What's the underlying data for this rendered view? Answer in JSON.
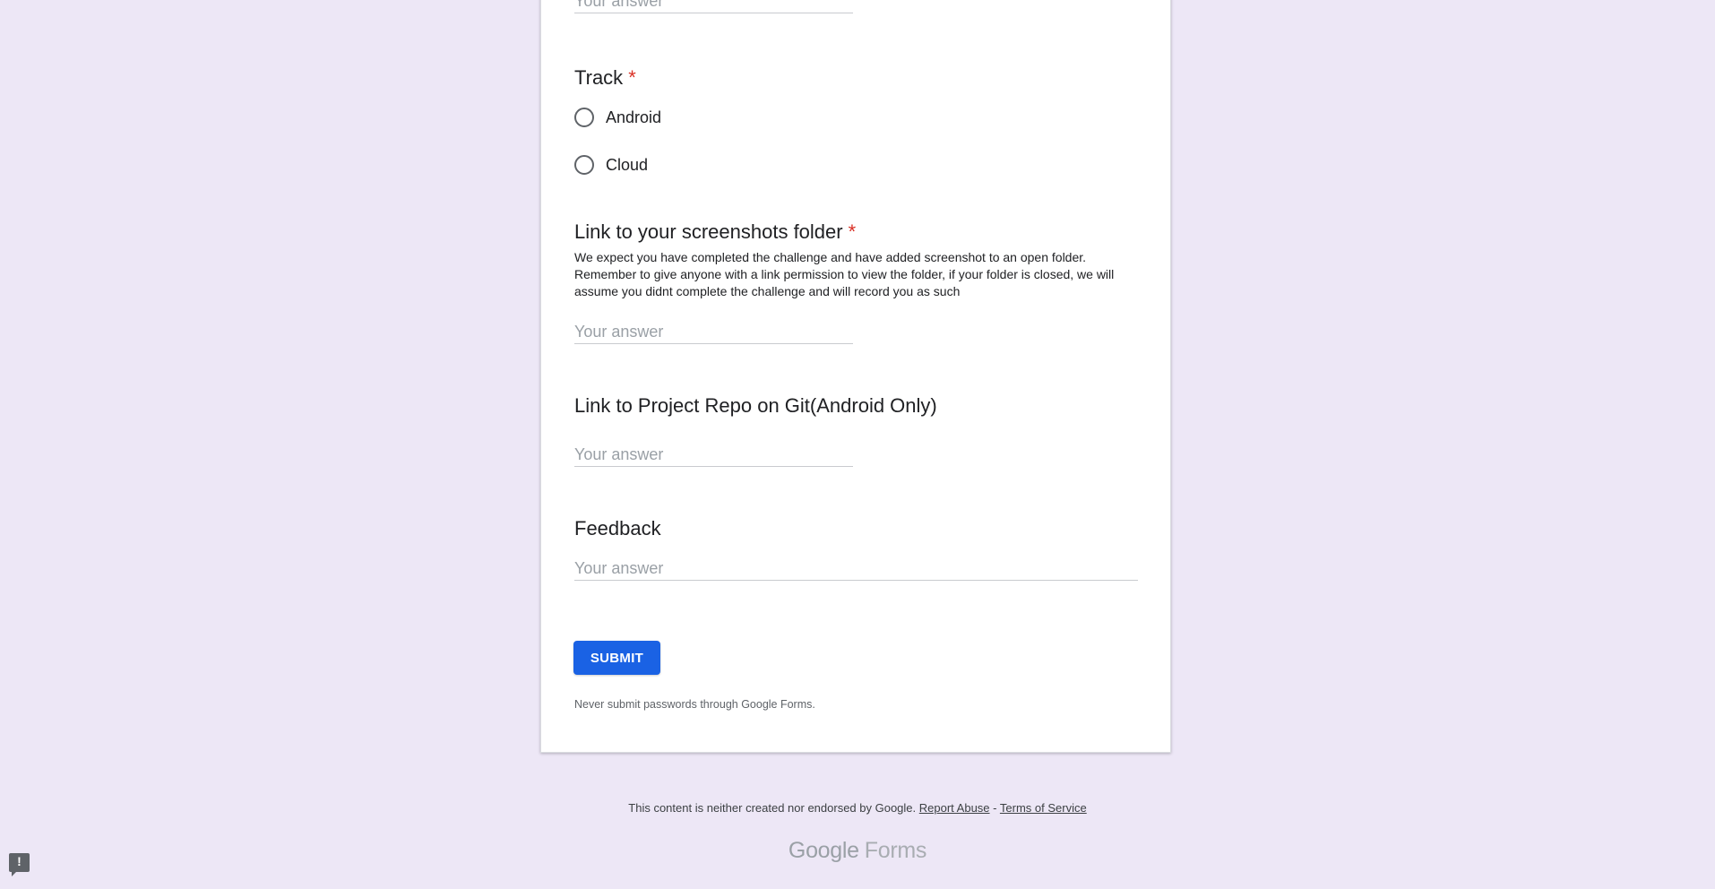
{
  "form": {
    "top_answer_placeholder": "Your answer",
    "track": {
      "title": "Track",
      "required_mark": "*",
      "options": [
        "Android",
        "Cloud"
      ]
    },
    "screenshots": {
      "title": "Link to your screenshots folder",
      "required_mark": "*",
      "description": "We expect you have completed the challenge and have added screenshot to an open folder. Remember to give anyone with a link permission to view the folder, if your folder is closed, we will assume you didnt complete the challenge and will record you as such",
      "placeholder": "Your answer"
    },
    "repo": {
      "title": "Link to Project Repo on Git(Android Only)",
      "placeholder": "Your answer"
    },
    "feedback": {
      "title": "Feedback",
      "placeholder": "Your answer"
    },
    "submit_label": "SUBMIT",
    "password_warning": "Never submit passwords through Google Forms."
  },
  "footer": {
    "disclaimer": "This content is neither created nor endorsed by Google.",
    "report_abuse": "Report Abuse",
    "separator": "-",
    "terms": "Terms of Service",
    "brand_google": "Google",
    "brand_forms": "Forms"
  },
  "icons": {
    "feedback": "report-problem-icon",
    "feedback_glyph": "!"
  },
  "colors": {
    "background": "#ede7f6",
    "accent": "#1a62e4",
    "required": "#d93025"
  }
}
